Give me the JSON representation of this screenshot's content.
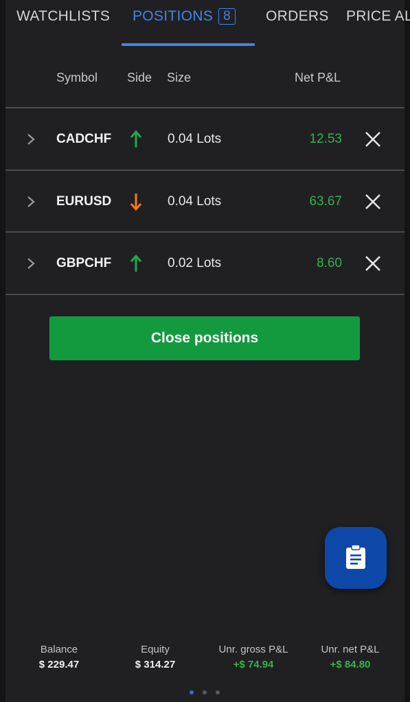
{
  "tabs": [
    {
      "label": "WATCHLISTS",
      "active": false
    },
    {
      "label": "POSITIONS",
      "badge": "8",
      "active": true
    },
    {
      "label": "ORDERS",
      "active": false
    },
    {
      "label": "PRICE AL",
      "active": false
    }
  ],
  "table": {
    "headers": {
      "symbol": "Symbol",
      "side": "Side",
      "size": "Size",
      "pnl": "Net P&L"
    },
    "rows": [
      {
        "symbol": "CADCHF",
        "side": "up-arrow-icon",
        "side_color": "#1fa84a",
        "size": "0.04 Lots",
        "pnl": "12.53"
      },
      {
        "symbol": "EURUSD",
        "side": "down-arrow-icon",
        "side_color": "#f07a1a",
        "size": "0.04 Lots",
        "pnl": "63.67"
      },
      {
        "symbol": "GBPCHF",
        "side": "up-arrow-icon",
        "side_color": "#1fa84a",
        "size": "0.02 Lots",
        "pnl": "8.60"
      }
    ]
  },
  "close_button": {
    "label": "Close positions"
  },
  "fab": {
    "icon": "clipboard-icon"
  },
  "footer": {
    "balance": {
      "label": "Balance",
      "value": "$ 229.47"
    },
    "equity": {
      "label": "Equity",
      "value": "$ 314.27"
    },
    "gross": {
      "label": "Unr. gross P&L",
      "value": "+$ 74.94"
    },
    "net": {
      "label": "Unr. net P&L",
      "value": "+$ 84.80"
    }
  },
  "pager": {
    "pages": 3,
    "active": 0
  },
  "colors": {
    "accent": "#3f86e6",
    "profit": "#35b24a",
    "button": "#139a3f",
    "fab": "#0d48a8"
  }
}
